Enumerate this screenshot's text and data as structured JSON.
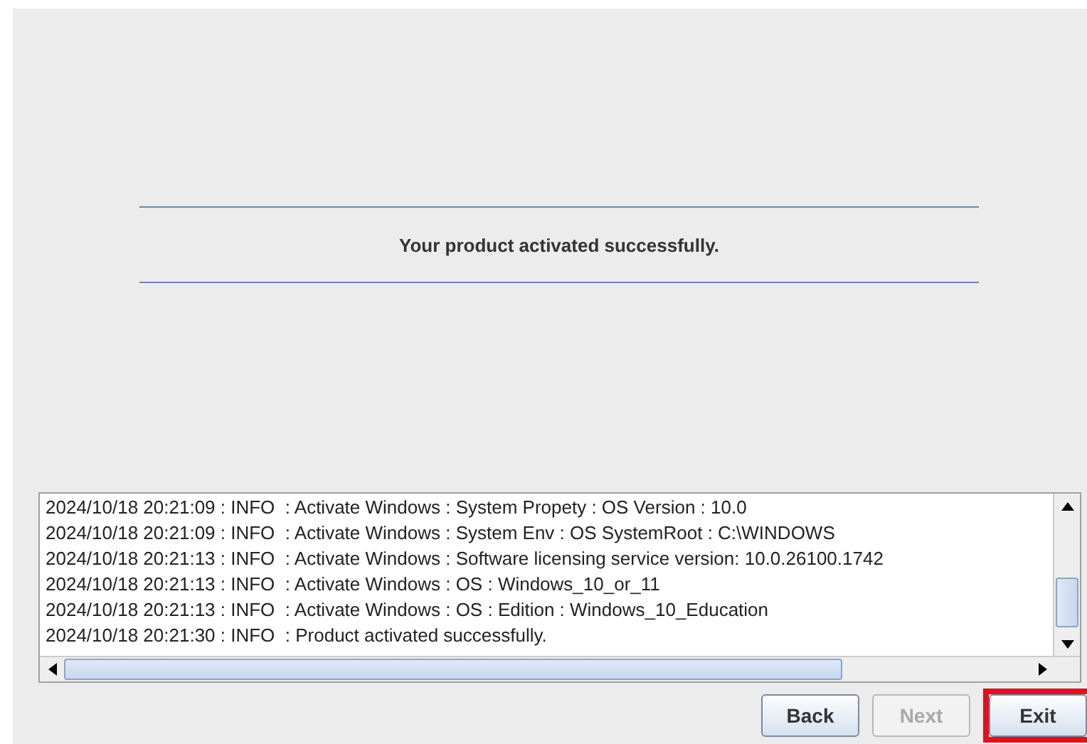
{
  "message": "Your product activated successfully.",
  "log": [
    "2024/10/18 20:21:09 : INFO  : Activate Windows : System Propety : OS Version : 10.0",
    "2024/10/18 20:21:09 : INFO  : Activate Windows : System Env : OS SystemRoot : C:\\WINDOWS",
    "2024/10/18 20:21:13 : INFO  : Activate Windows : Software licensing service version: 10.0.26100.1742",
    "2024/10/18 20:21:13 : INFO  : Activate Windows : OS : Windows_10_or_11",
    "2024/10/18 20:21:13 : INFO  : Activate Windows : OS : Edition : Windows_10_Education",
    "2024/10/18 20:21:30 : INFO  : Product activated successfully."
  ],
  "buttons": [
    {
      "label": "Back",
      "disabled": false,
      "highlighted": false
    },
    {
      "label": "Next",
      "disabled": true,
      "highlighted": false
    },
    {
      "label": "Exit",
      "disabled": false,
      "highlighted": true
    }
  ]
}
